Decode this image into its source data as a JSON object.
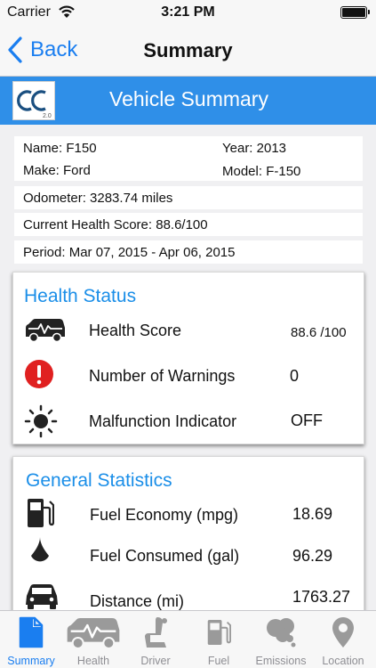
{
  "status_bar": {
    "carrier": "Carrier",
    "time": "3:21 PM"
  },
  "nav": {
    "back_label": "Back",
    "title": "Summary"
  },
  "banner": {
    "title": "Vehicle Summary",
    "logo_text": "2.0"
  },
  "vehicle": {
    "name": "Name:  F150",
    "year": "Year: 2013",
    "make": "Make: Ford",
    "model": "Model: F-150",
    "odometer": "Odometer:  3283.74  miles",
    "health_score": "Current Health Score:  88.6/100",
    "period": "Period: Mar 07, 2015 - Apr 06, 2015"
  },
  "health_status": {
    "title": "Health Status",
    "rows": [
      {
        "label": "Health Score",
        "value": "88.6 /100",
        "icon": "car-heartbeat-icon"
      },
      {
        "label": "Number of Warnings",
        "value": "0",
        "icon": "warning-icon"
      },
      {
        "label": "Malfunction Indicator",
        "value": "OFF",
        "icon": "sun-indicator-icon"
      }
    ]
  },
  "general_statistics": {
    "title": "General Statistics",
    "rows": [
      {
        "label": "Fuel Economy (mpg)",
        "value": "18.69",
        "icon": "fuel-pump-icon"
      },
      {
        "label": "Fuel Consumed (gal)",
        "value": "96.29",
        "icon": "fuel-drop-icon"
      },
      {
        "label": "Distance (mi)",
        "value": "1763.27",
        "icon": "car-icon"
      }
    ]
  },
  "tabs": [
    {
      "label": "Summary",
      "icon": "document-icon",
      "active": true
    },
    {
      "label": "Health",
      "icon": "car-heartbeat-icon"
    },
    {
      "label": "Driver",
      "icon": "seat-icon"
    },
    {
      "label": "Fuel",
      "icon": "fuel-pump-icon"
    },
    {
      "label": "Emissions",
      "icon": "smoke-icon"
    },
    {
      "label": "Location",
      "icon": "location-pin-icon"
    }
  ],
  "colors": {
    "accent": "#1a7ef0",
    "banner": "#2f8fe8",
    "section_title": "#1a8ee8",
    "warning": "#e02020"
  }
}
